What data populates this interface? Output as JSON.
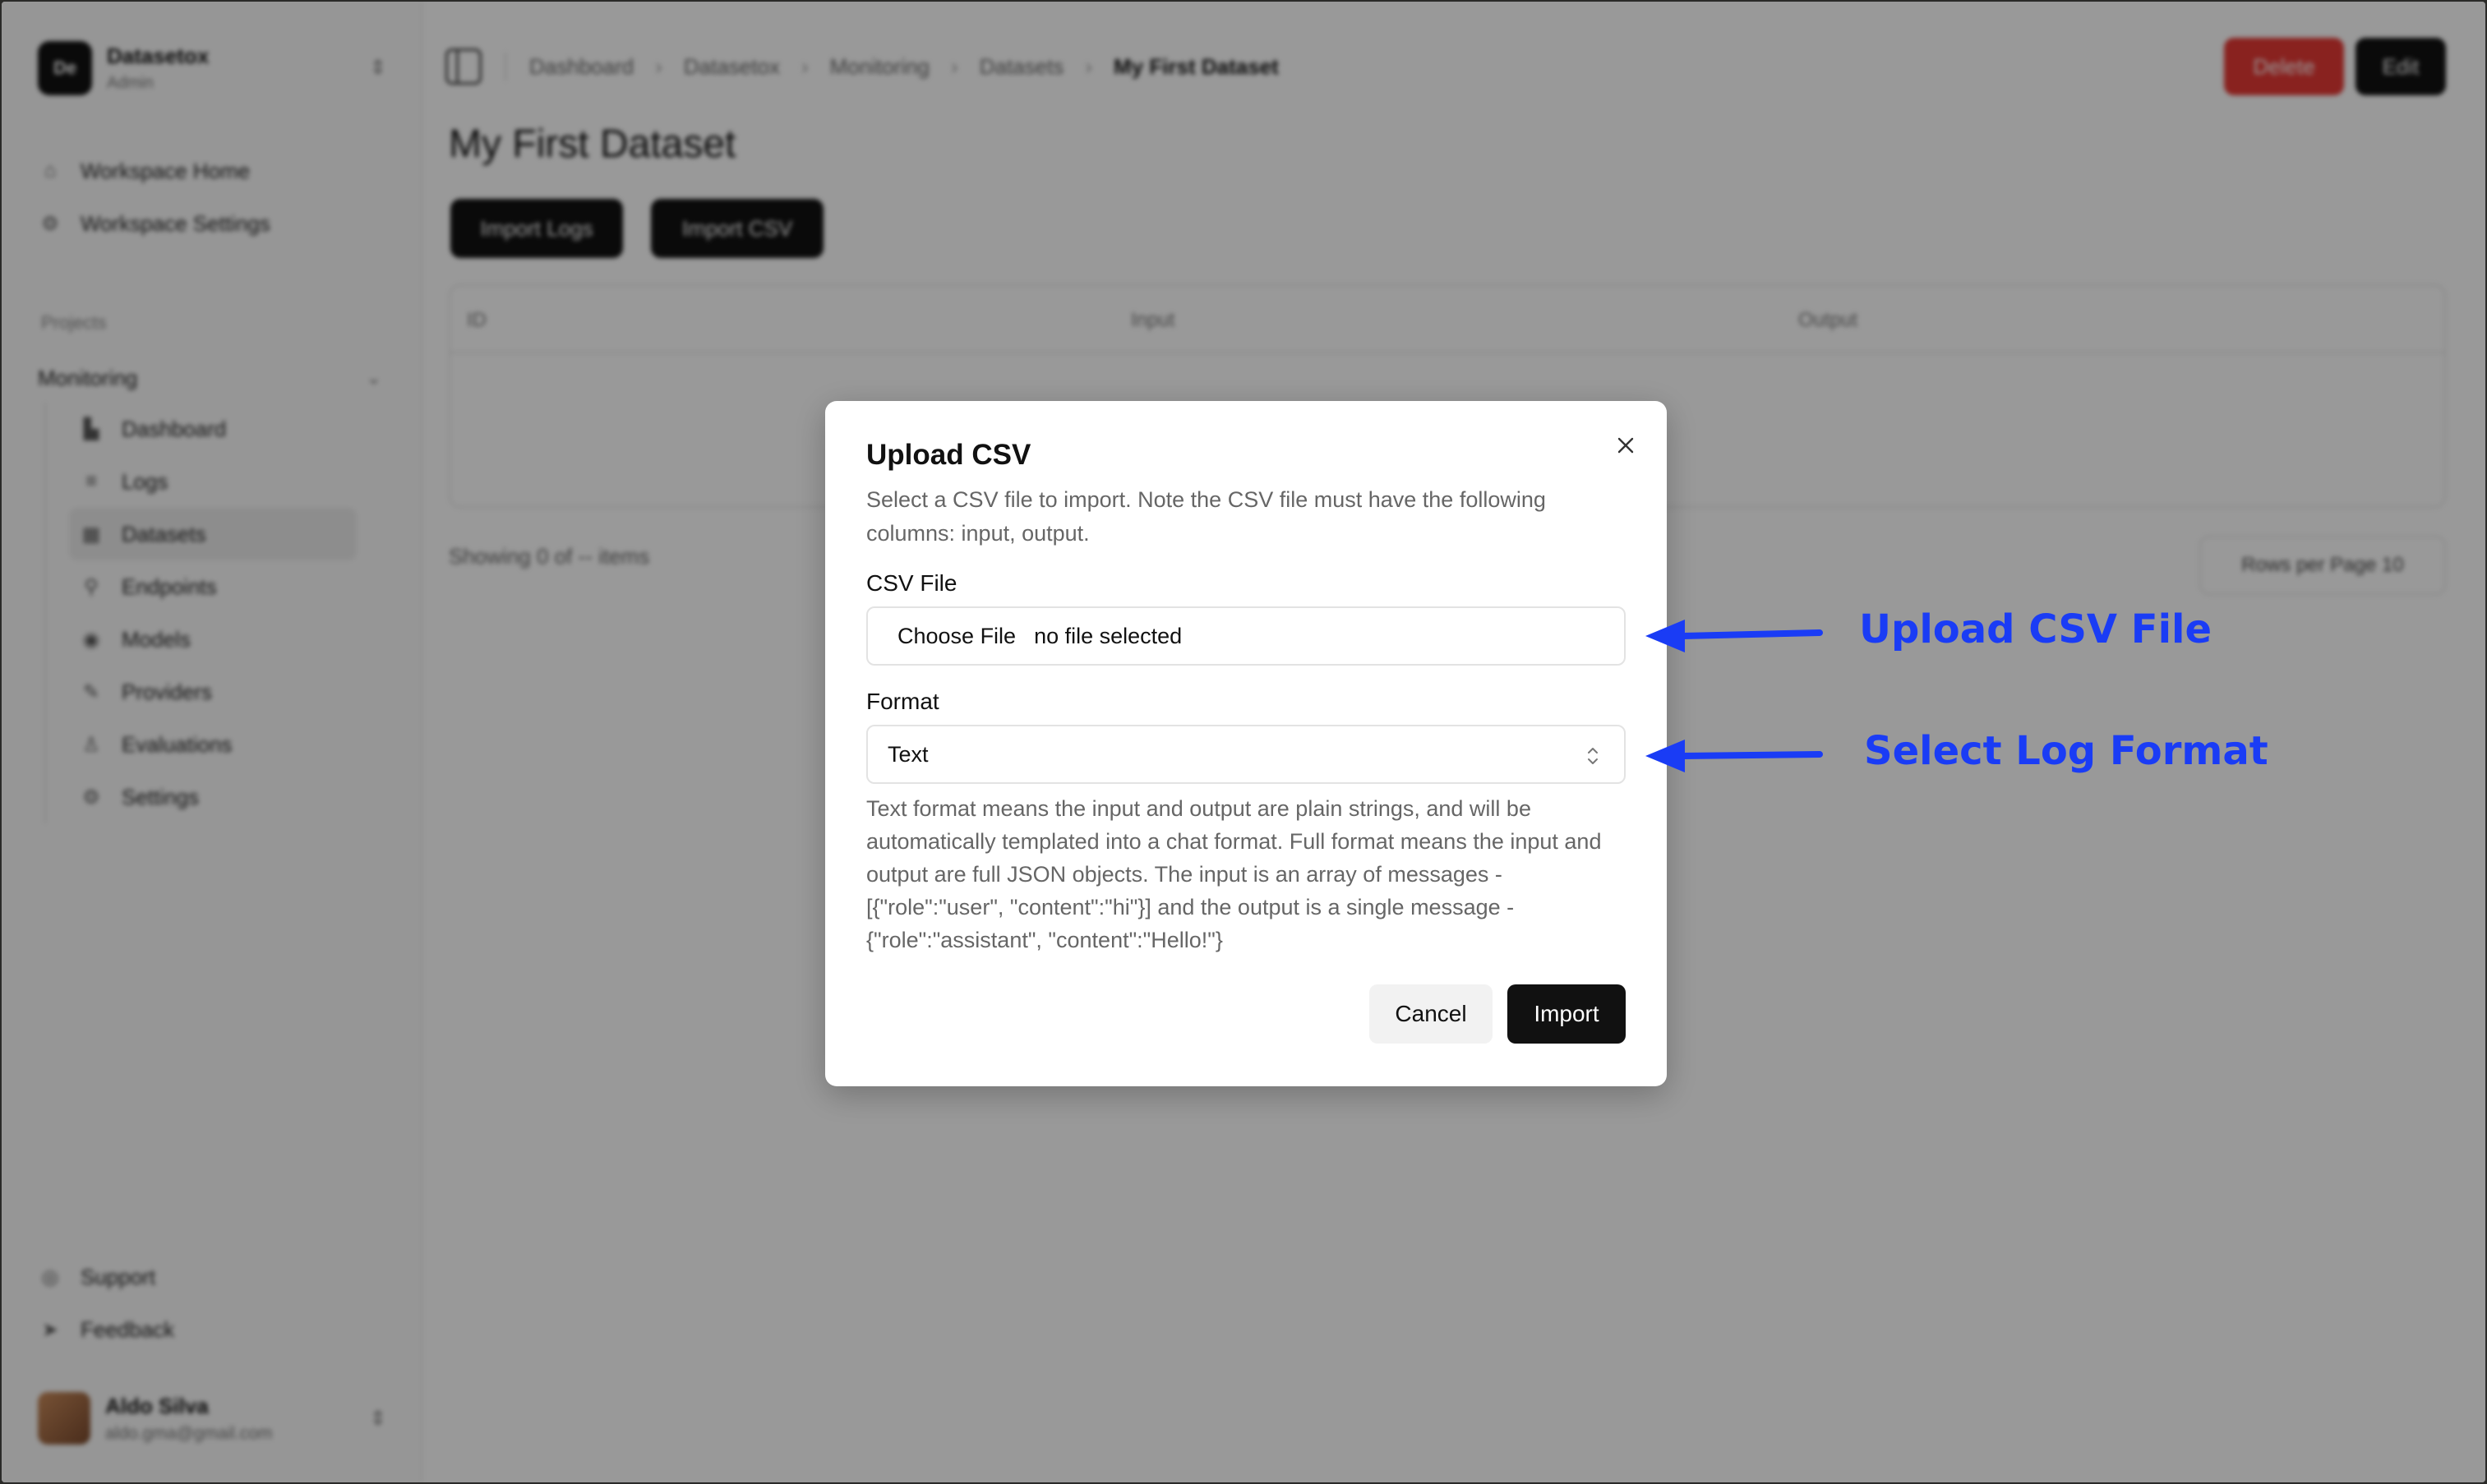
{
  "workspace": {
    "logo_text": "De",
    "name": "Datasetox",
    "plan": "Admin"
  },
  "sidebar": {
    "top_items": [
      {
        "label": "Workspace Home",
        "icon": "home-icon"
      },
      {
        "label": "Workspace Settings",
        "icon": "gear-icon"
      }
    ],
    "section_label": "Projects",
    "group_label": "Monitoring",
    "sub_items": [
      {
        "label": "Dashboard",
        "icon": "chart-icon"
      },
      {
        "label": "Logs",
        "icon": "logs-icon"
      },
      {
        "label": "Datasets",
        "icon": "table-icon",
        "active": true
      },
      {
        "label": "Endpoints",
        "icon": "endpoint-icon"
      },
      {
        "label": "Models",
        "icon": "model-icon"
      },
      {
        "label": "Providers",
        "icon": "provider-icon"
      },
      {
        "label": "Evaluations",
        "icon": "evaluation-icon"
      },
      {
        "label": "Settings",
        "icon": "gear-icon"
      }
    ],
    "bottom_items": [
      {
        "label": "Support",
        "icon": "support-icon"
      },
      {
        "label": "Feedback",
        "icon": "send-icon"
      }
    ],
    "user": {
      "name": "Aldo Silva",
      "email": "aldo.gma@gmail.com"
    }
  },
  "header": {
    "breadcrumbs": [
      "Dashboard",
      "Datasetox",
      "Monitoring",
      "Datasets",
      "My First Dataset"
    ],
    "delete_label": "Delete",
    "edit_label": "Edit"
  },
  "page": {
    "title": "My First Dataset",
    "import_logs_label": "Import Logs",
    "import_csv_label": "Import CSV",
    "columns": [
      "ID",
      "Input",
      "Output"
    ],
    "footer_text": "Showing 0 of -- items",
    "rows_per_page_label": "Rows per Page",
    "rows_per_page_value": "10"
  },
  "dialog": {
    "title": "Upload CSV",
    "description": "Select a CSV file to import. Note the CSV file must have the following columns: input, output.",
    "file_label": "CSV File",
    "choose_file_label": "Choose File",
    "file_status": "no file selected",
    "format_label": "Format",
    "format_value": "Text",
    "format_help": "Text format means the input and output are plain strings, and will be automatically templated into a chat format. Full format means the input and output are full JSON objects. The input is an array of messages - [{\"role\":\"user\", \"content\":\"hi\"}] and the output is a single message - {\"role\":\"assistant\", \"content\":\"Hello!\"}",
    "cancel_label": "Cancel",
    "import_label": "Import"
  },
  "annotations": {
    "upload_text": "Upload CSV File",
    "format_text": "Select Log Format",
    "color": "#1a3cf5"
  },
  "colors": {
    "delete": "#e53935",
    "primary": "#111111",
    "overlay": "rgba(0,0,0,0.4)"
  }
}
